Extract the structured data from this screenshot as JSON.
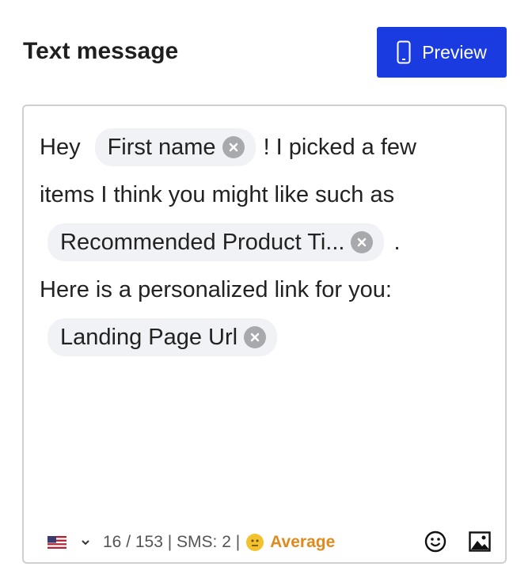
{
  "header": {
    "title": "Text message",
    "preview_label": "Preview"
  },
  "editor": {
    "line1": {
      "pre": "Hey",
      "chip": "First name",
      "post": "! I picked a few"
    },
    "line2": {
      "text": "items I think you might like such as"
    },
    "line3": {
      "chip": "Recommended Product Ti...",
      "post": "."
    },
    "line4": {
      "text": "Here is a personalized link for you:"
    },
    "line5": {
      "chip": "Landing Page Url"
    }
  },
  "footer": {
    "country_flag": "us-flag",
    "counter": "16 / 153 | SMS: 2 |",
    "quality_label": "Average",
    "quality_color": "#e08a1e",
    "emoji_icon": "smiley-icon",
    "image_icon": "image-icon"
  },
  "colors": {
    "primary": "#1a3be0",
    "chip_bg": "#f0f2f6",
    "chip_close": "#a8a9ad"
  }
}
